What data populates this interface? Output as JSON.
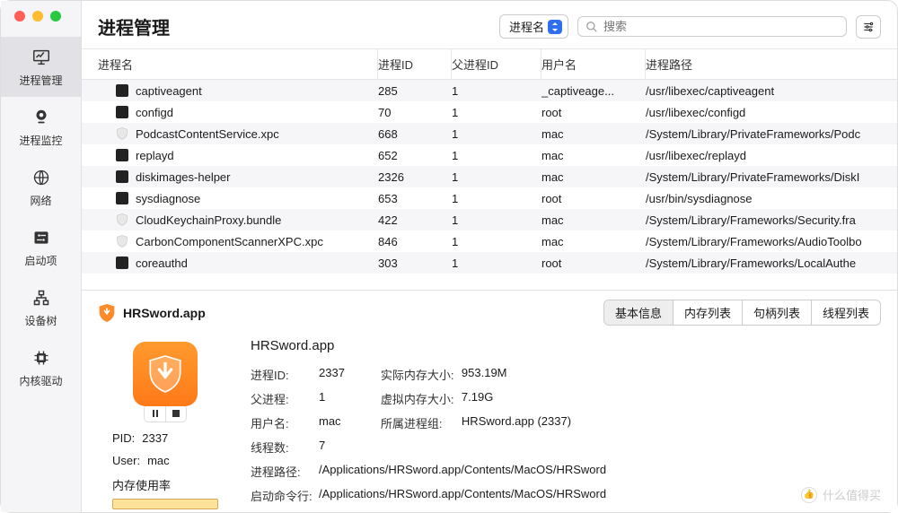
{
  "header": {
    "title": "进程管理",
    "filter_label": "进程名",
    "search_placeholder": "搜索"
  },
  "sidebar": {
    "items": [
      {
        "label": "进程管理"
      },
      {
        "label": "进程监控"
      },
      {
        "label": "网络"
      },
      {
        "label": "启动项"
      },
      {
        "label": "设备树"
      },
      {
        "label": "内核驱动"
      }
    ]
  },
  "columns": {
    "name": "进程名",
    "pid": "进程ID",
    "ppid": "父进程ID",
    "user": "用户名",
    "path": "进程路径"
  },
  "rows": [
    {
      "icon": "term",
      "name": "captiveagent",
      "pid": "285",
      "ppid": "1",
      "user": "_captiveage...",
      "path": "/usr/libexec/captiveagent"
    },
    {
      "icon": "term",
      "name": "configd",
      "pid": "70",
      "ppid": "1",
      "user": "root",
      "path": "/usr/libexec/configd"
    },
    {
      "icon": "shield",
      "name": "PodcastContentService.xpc",
      "pid": "668",
      "ppid": "1",
      "user": "mac",
      "path": "/System/Library/PrivateFrameworks/Podc"
    },
    {
      "icon": "term",
      "name": "replayd",
      "pid": "652",
      "ppid": "1",
      "user": "mac",
      "path": "/usr/libexec/replayd"
    },
    {
      "icon": "term",
      "name": "diskimages-helper",
      "pid": "2326",
      "ppid": "1",
      "user": "mac",
      "path": "/System/Library/PrivateFrameworks/DiskI"
    },
    {
      "icon": "term",
      "name": "sysdiagnose",
      "pid": "653",
      "ppid": "1",
      "user": "root",
      "path": "/usr/bin/sysdiagnose"
    },
    {
      "icon": "shield",
      "name": "CloudKeychainProxy.bundle",
      "pid": "422",
      "ppid": "1",
      "user": "mac",
      "path": "/System/Library/Frameworks/Security.fra"
    },
    {
      "icon": "shield",
      "name": "CarbonComponentScannerXPC.xpc",
      "pid": "846",
      "ppid": "1",
      "user": "mac",
      "path": "/System/Library/Frameworks/AudioToolbo"
    },
    {
      "icon": "term",
      "name": "coreauthd",
      "pid": "303",
      "ppid": "1",
      "user": "root",
      "path": "/System/Library/Frameworks/LocalAuthe"
    }
  ],
  "detail": {
    "app_name": "HRSword.app",
    "tabs": [
      "基本信息",
      "内存列表",
      "句柄列表",
      "线程列表"
    ],
    "left": {
      "pid_label": "PID:",
      "pid_value": "2337",
      "user_label": "User:",
      "user_value": "mac",
      "mem_label": "内存使用率"
    },
    "right": {
      "title": "HRSword.app",
      "col1": [
        {
          "k": "进程ID:",
          "v": "2337"
        },
        {
          "k": "父进程:",
          "v": "1"
        },
        {
          "k": "用户名:",
          "v": "mac"
        },
        {
          "k": "线程数:",
          "v": "7"
        }
      ],
      "col2": [
        {
          "k": "实际内存大小:",
          "v": "953.19M"
        },
        {
          "k": "虚拟内存大小:",
          "v": "7.19G"
        },
        {
          "k": "所属进程组:",
          "v": "HRSword.app (2337)"
        }
      ],
      "full": [
        {
          "k": "进程路径:",
          "v": "/Applications/HRSword.app/Contents/MacOS/HRSword"
        },
        {
          "k": "启动命令行:",
          "v": "/Applications/HRSword.app/Contents/MacOS/HRSword"
        }
      ]
    }
  },
  "watermark": "什么值得买"
}
